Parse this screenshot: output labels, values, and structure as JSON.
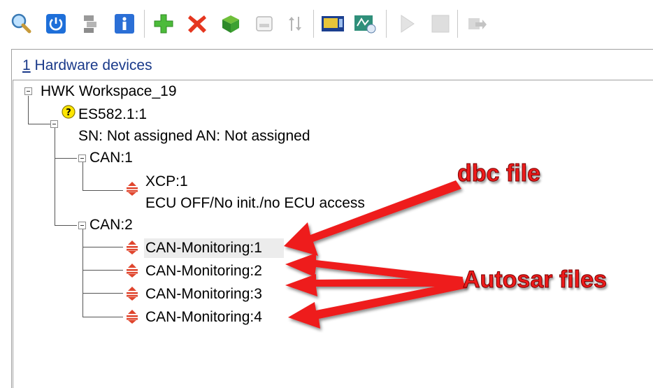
{
  "toolbar": {
    "icons": [
      "search-icon",
      "power-icon",
      "connect-devices-icon",
      "info-icon",
      "add-icon",
      "delete-icon",
      "open-box-icon",
      "memory-card-icon",
      "sort-icon",
      "hardware-config-icon",
      "network-config-icon",
      "play-icon",
      "stop-icon",
      "export-icon"
    ]
  },
  "header": {
    "count": "1",
    "label": " Hardware devices"
  },
  "tree": {
    "root": "HWK Workspace_19",
    "device": "ES582.1:1",
    "device_status": "SN: Not assigned AN: Not assigned",
    "can1": "CAN:1",
    "xcp": "XCP:1",
    "xcp_status": "ECU OFF/No init./no ECU access",
    "can2": "CAN:2",
    "mon1": "CAN-Monitoring:1",
    "mon2": "CAN-Monitoring:2",
    "mon3": "CAN-Monitoring:3",
    "mon4": "CAN-Monitoring:4"
  },
  "annotations": {
    "dbc": "dbc file",
    "autosar": "Autosar files",
    "arrow_color": "#ee1b1b"
  }
}
